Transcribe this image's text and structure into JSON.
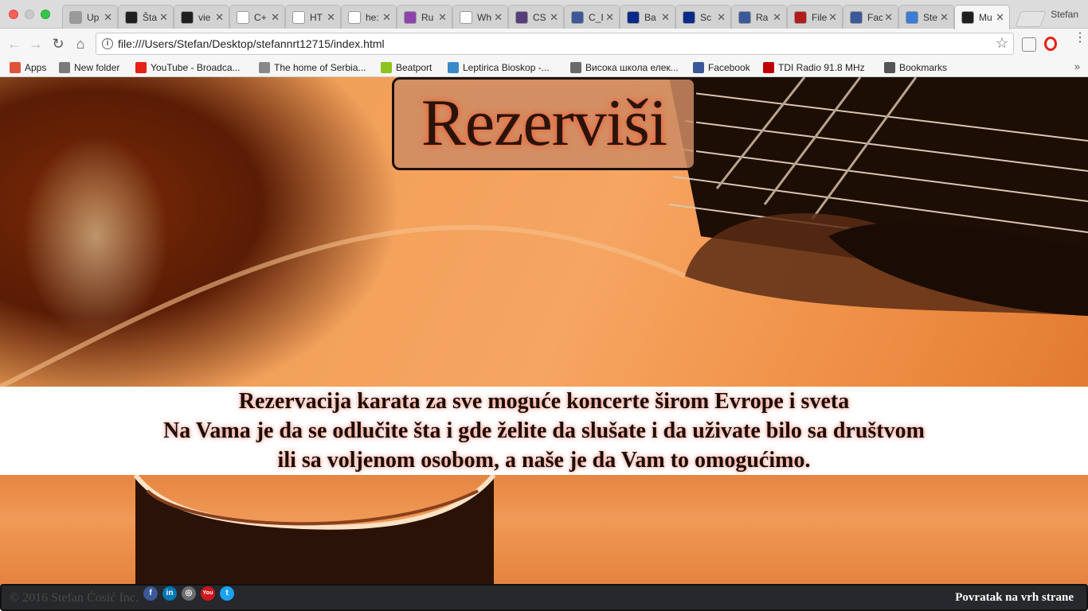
{
  "browser": {
    "profile_name": "Stefan",
    "tabs": [
      {
        "title": "Up",
        "favicon": "document-icon",
        "color": "#9a9a9a"
      },
      {
        "title": "Šta",
        "favicon": "plex-icon",
        "color": "#1f1f1f"
      },
      {
        "title": "vie",
        "favicon": "plex-icon",
        "color": "#1f1f1f"
      },
      {
        "title": "C+",
        "favicon": "wikipedia-icon",
        "color": "#ffffff"
      },
      {
        "title": "HT",
        "favicon": "wikipedia-icon",
        "color": "#ffffff"
      },
      {
        "title": "he:",
        "favicon": "google-icon",
        "color": "#ffffff"
      },
      {
        "title": "Ru",
        "favicon": "flower-icon",
        "color": "#8e44ad"
      },
      {
        "title": "Wh",
        "favicon": "quora-icon",
        "color": "#ffffff"
      },
      {
        "title": "CS",
        "favicon": "bootstrap-icon",
        "color": "#563d7c"
      },
      {
        "title": "C_I",
        "favicon": "facebook-icon",
        "color": "#3b5998"
      },
      {
        "title": "Ba",
        "favicon": "p-icon",
        "color": "#0a2a8a"
      },
      {
        "title": "Sc",
        "favicon": "p-icon",
        "color": "#0a2a8a"
      },
      {
        "title": "Ra",
        "favicon": "facebook-icon",
        "color": "#3b5998"
      },
      {
        "title": "File",
        "favicon": "filezilla-icon",
        "color": "#b31b1b"
      },
      {
        "title": "Fac",
        "favicon": "facebook-icon",
        "color": "#3b5998"
      },
      {
        "title": "Ste",
        "favicon": "globe-icon",
        "color": "#3d7bd6"
      },
      {
        "title": "Mu",
        "favicon": "site-icon",
        "color": "#1f1f1f",
        "active": true
      }
    ],
    "url": "file:///Users/Stefan/Desktop/stefannrt12715/index.html",
    "bookmarks": [
      {
        "label": "Apps",
        "icon": "apps-grid-icon"
      },
      {
        "label": "New folder",
        "icon": "folder-icon"
      },
      {
        "label": "YouTube - Broadca...",
        "icon": "youtube-icon"
      },
      {
        "label": "The home of Serbia...",
        "icon": "page-icon"
      },
      {
        "label": "Beatport",
        "icon": "beatport-icon"
      },
      {
        "label": "Leptirica Bioskop -...",
        "icon": "butterfly-icon"
      },
      {
        "label": "Висока школа елек...",
        "icon": "wave-icon"
      },
      {
        "label": "Facebook",
        "icon": "facebook-icon"
      },
      {
        "label": "TDI Radio 91.8 MHz",
        "icon": "tdi-icon"
      },
      {
        "label": "Bookmarks",
        "icon": "star-icon"
      }
    ],
    "more_bookmarks": "»"
  },
  "page": {
    "title": "Rezerviši",
    "band_lines": [
      "Rezervacija karata za sve moguće koncerte širom Evrope i sveta",
      "Na Vama je da se odlučite šta i gde želite da slušate i da uživate bilo sa društvom",
      "ili sa voljenom osobom, a naše je da Vam to omogućimo."
    ],
    "footer": {
      "copyright": "© 2016 Stefan Ćosić Inc.",
      "back_to_top": "Povratak na vrh strane",
      "social": [
        {
          "name": "facebook-icon",
          "glyph": "f",
          "color": "#3b5998"
        },
        {
          "name": "linkedin-icon",
          "glyph": "in",
          "color": "#0077b5"
        },
        {
          "name": "instagram-icon",
          "glyph": "◎",
          "color": "#6d6d6d"
        },
        {
          "name": "youtube-icon",
          "glyph": "You",
          "color": "#cc181e"
        },
        {
          "name": "twitter-icon",
          "glyph": "t",
          "color": "#1da1f2"
        }
      ]
    }
  }
}
